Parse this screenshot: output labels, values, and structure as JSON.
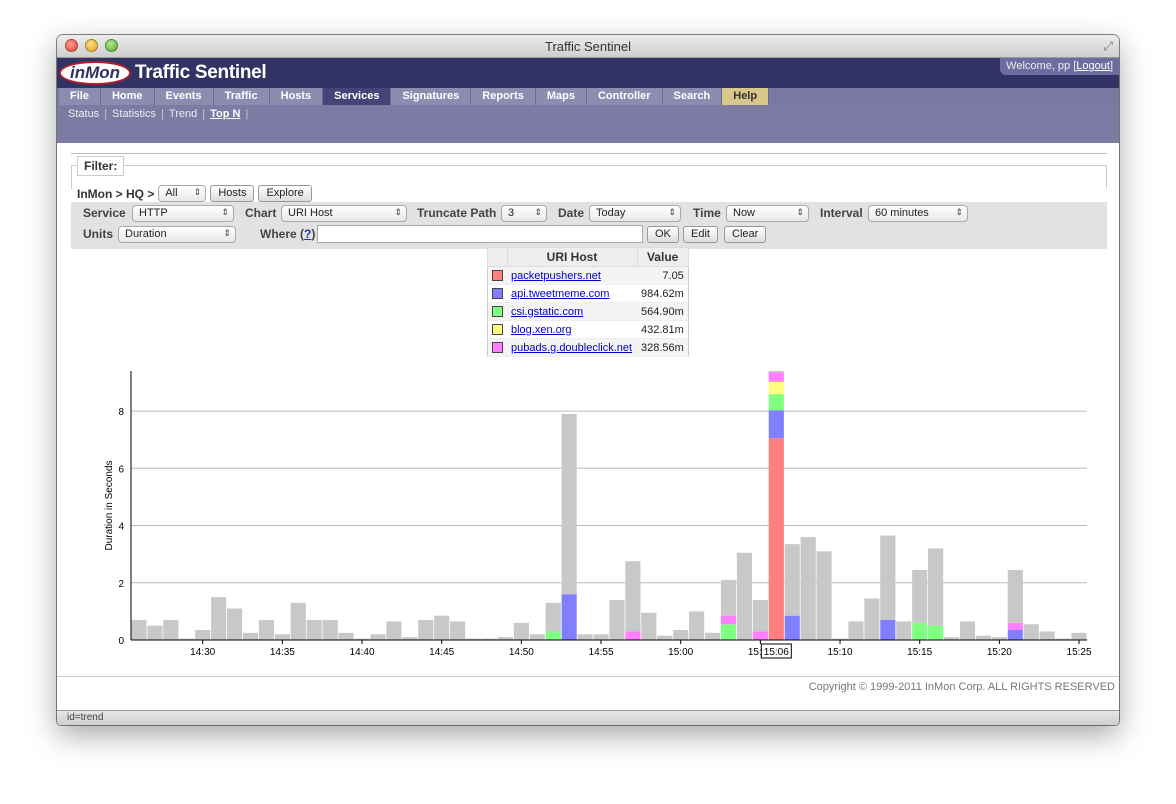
{
  "window": {
    "title": "Traffic Sentinel"
  },
  "banner": {
    "logo": "inMon",
    "app_name": "Traffic Sentinel",
    "welcome": "Welcome, pp [",
    "logout": "Logout",
    "welcome_end": "]"
  },
  "menu": [
    {
      "label": "File"
    },
    {
      "label": "Home"
    },
    {
      "label": "Events"
    },
    {
      "label": "Traffic"
    },
    {
      "label": "Hosts"
    },
    {
      "label": "Services",
      "active": true
    },
    {
      "label": "Signatures"
    },
    {
      "label": "Reports"
    },
    {
      "label": "Maps"
    },
    {
      "label": "Controller"
    },
    {
      "label": "Search"
    },
    {
      "label": "Help",
      "help": true
    }
  ],
  "submenu": [
    {
      "label": "Status"
    },
    {
      "label": "Statistics"
    },
    {
      "label": "Trend"
    },
    {
      "label": "Top N",
      "current": true
    }
  ],
  "filter": {
    "legend": "Filter:",
    "path": "InMon > HQ >",
    "scope": "All",
    "hosts_button": "Hosts",
    "explore_button": "Explore"
  },
  "controls": {
    "service_label": "Service",
    "service_value": "HTTP",
    "chart_label": "Chart",
    "chart_value": "URI Host",
    "truncate_label": "Truncate Path",
    "truncate_value": "3",
    "date_label": "Date",
    "date_value": "Today",
    "time_label": "Time",
    "time_value": "Now",
    "interval_label": "Interval",
    "interval_value": "60 minutes",
    "units_label": "Units",
    "units_value": "Duration",
    "where_label": "Where (",
    "where_help": "?",
    "where_end": ")",
    "where_value": "",
    "ok_button": "OK",
    "edit_button": "Edit",
    "clear_button": "Clear"
  },
  "legend_table": {
    "col1": "URI Host",
    "col2": "Value",
    "rows": [
      {
        "color": "#ff7f7f",
        "host": "packetpushers.net",
        "value": "7.05"
      },
      {
        "color": "#7f7fff",
        "host": "api.tweetmeme.com",
        "value": "984.62m"
      },
      {
        "color": "#7fff7f",
        "host": "csi.gstatic.com",
        "value": "564.90m"
      },
      {
        "color": "#ffff7f",
        "host": "blog.xen.org",
        "value": "432.81m"
      },
      {
        "color": "#ff7fff",
        "host": "pubads.g.doubleclick.net",
        "value": "328.56m"
      }
    ]
  },
  "chart_data": {
    "type": "bar",
    "stacked": true,
    "ylabel": "Duration in Seconds",
    "ylim": [
      0,
      9.4
    ],
    "yticks": [
      0,
      2,
      4,
      6,
      8
    ],
    "xtick_labels": [
      "14:30",
      "14:35",
      "14:40",
      "14:45",
      "14:50",
      "14:55",
      "15:00",
      "15:05",
      "15:10",
      "15:15",
      "15:20",
      "15:25"
    ],
    "highlight_label": "15:06",
    "grid": true,
    "bars": [
      {
        "t": "14:26",
        "other": 0.7
      },
      {
        "t": "14:27",
        "other": 0.5
      },
      {
        "t": "14:28",
        "other": 0.7
      },
      {
        "t": "14:29",
        "other": 0.05
      },
      {
        "t": "14:30",
        "other": 0.35
      },
      {
        "t": "14:31",
        "other": 1.5
      },
      {
        "t": "14:32",
        "other": 1.1
      },
      {
        "t": "14:33",
        "other": 0.25
      },
      {
        "t": "14:34",
        "other": 0.7
      },
      {
        "t": "14:35",
        "other": 0.2
      },
      {
        "t": "14:36",
        "other": 1.3
      },
      {
        "t": "14:37",
        "other": 0.7
      },
      {
        "t": "14:38",
        "other": 0.7
      },
      {
        "t": "14:39",
        "other": 0.25
      },
      {
        "t": "14:40",
        "other": 0.05
      },
      {
        "t": "14:41",
        "other": 0.2
      },
      {
        "t": "14:42",
        "other": 0.65
      },
      {
        "t": "14:43",
        "other": 0.1
      },
      {
        "t": "14:44",
        "other": 0.7
      },
      {
        "t": "14:45",
        "other": 0.85
      },
      {
        "t": "14:46",
        "other": 0.65
      },
      {
        "t": "14:47",
        "other": 0.05
      },
      {
        "t": "14:48",
        "other": 0.05
      },
      {
        "t": "14:49",
        "other": 0.1
      },
      {
        "t": "14:50",
        "other": 0.6
      },
      {
        "t": "14:51",
        "other": 0.2
      },
      {
        "t": "14:52",
        "other": 1.0,
        "green": 0.3
      },
      {
        "t": "14:53",
        "other": 6.3,
        "blue": 1.6
      },
      {
        "t": "14:54",
        "other": 0.2
      },
      {
        "t": "14:55",
        "other": 0.2
      },
      {
        "t": "14:56",
        "other": 1.4
      },
      {
        "t": "14:57",
        "other": 2.45,
        "pink": 0.3
      },
      {
        "t": "14:58",
        "other": 0.95
      },
      {
        "t": "14:59",
        "other": 0.15
      },
      {
        "t": "15:00",
        "other": 0.35
      },
      {
        "t": "15:01",
        "other": 1.0
      },
      {
        "t": "15:02",
        "other": 0.25
      },
      {
        "t": "15:03",
        "other": 1.25,
        "green": 0.55,
        "pink": 0.3
      },
      {
        "t": "15:04",
        "other": 3.05
      },
      {
        "t": "15:05",
        "other": 1.1,
        "pink": 0.3
      },
      {
        "t": "15:06",
        "other": 0.05,
        "red": 7.05,
        "blue": 0.98,
        "green": 0.56,
        "yellow": 0.43,
        "pink": 0.33
      },
      {
        "t": "15:07",
        "other": 2.5,
        "blue": 0.85
      },
      {
        "t": "15:08",
        "other": 3.6
      },
      {
        "t": "15:09",
        "other": 3.1
      },
      {
        "t": "15:10",
        "other": 0.05
      },
      {
        "t": "15:11",
        "other": 0.65
      },
      {
        "t": "15:12",
        "other": 1.45
      },
      {
        "t": "15:13",
        "other": 2.95,
        "blue": 0.7
      },
      {
        "t": "15:14",
        "other": 0.65
      },
      {
        "t": "15:15",
        "other": 1.85,
        "green": 0.6
      },
      {
        "t": "15:16",
        "other": 2.7,
        "green": 0.5
      },
      {
        "t": "15:17",
        "other": 0.1
      },
      {
        "t": "15:18",
        "other": 0.65
      },
      {
        "t": "15:19",
        "other": 0.15
      },
      {
        "t": "15:20",
        "other": 0.1
      },
      {
        "t": "15:21",
        "other": 1.85,
        "blue": 0.35,
        "pink": 0.25
      },
      {
        "t": "15:22",
        "other": 0.55
      },
      {
        "t": "15:23",
        "other": 0.3
      },
      {
        "t": "15:24",
        "other": 0.05
      },
      {
        "t": "15:25",
        "other": 0.25
      }
    ],
    "colors": {
      "other": "#c8c8c8",
      "red": "#ff7f7f",
      "blue": "#7f7fff",
      "green": "#7fff7f",
      "yellow": "#ffff7f",
      "pink": "#ff7fff"
    }
  },
  "footer": {
    "copyright": "Copyright © 1999-2011 InMon Corp. ALL RIGHTS RESERVED"
  },
  "statusbar": {
    "text": "id=trend"
  }
}
